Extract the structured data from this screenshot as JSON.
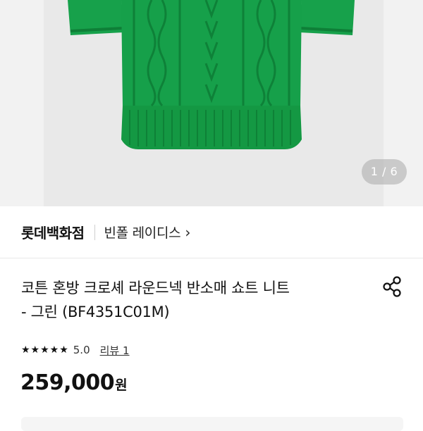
{
  "gallery": {
    "counter": "1 / 6",
    "image_subject": "green cable-knit short sleeve sweater",
    "colors": {
      "sweater": "#15a04a",
      "sweater_dark": "#0b7a34",
      "background": "#e9e9e9"
    }
  },
  "brand": {
    "store": "롯데백화점",
    "brand_name": "빈폴 레이디스",
    "chevron": "›"
  },
  "product": {
    "title_line1": "코튼 혼방 크로셰 라운드넥 반소매 쇼트 니트",
    "title_line2": "- 그린 (BF4351C01M)",
    "share_icon": "share-icon"
  },
  "rating": {
    "stars": "★★★★★",
    "score": "5.0",
    "reviews_label": "리뷰 1"
  },
  "price": {
    "amount": "259,000",
    "unit": "원"
  }
}
